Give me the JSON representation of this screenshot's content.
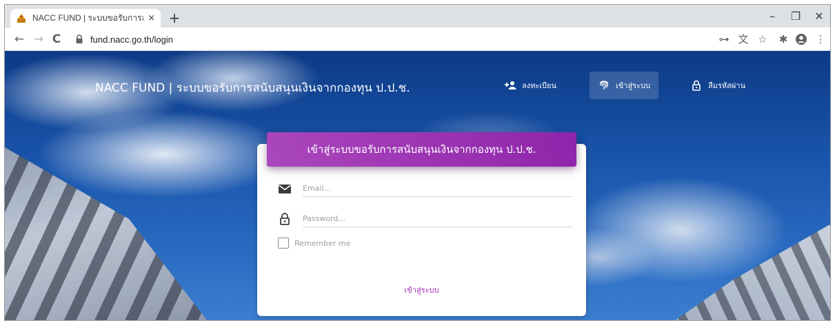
{
  "browser": {
    "tab_title": "NACC FUND | ระบบขอรับการสนับสนุนเงินจากกองทุน ป.ป.ช.",
    "tab_close": "×",
    "new_tab": "+",
    "url": "fund.nacc.go.th/login",
    "window_controls": {
      "minimize": "–",
      "restore": "❐",
      "close": "✕"
    },
    "nav": {
      "back": "←",
      "forward": "→",
      "reload": "C"
    },
    "toolbar_icons": {
      "key": "⊶",
      "translate": "⽂",
      "star": "☆",
      "extensions": "✱",
      "menu": "⋮"
    }
  },
  "page": {
    "brand": "NACC FUND | ระบบขอรับการสนับสนุนเงินจากกองทุน ป.ป.ช.",
    "nav_links": [
      {
        "label": "ลงทะเบียน",
        "icon": "add-user-icon"
      },
      {
        "label": "เข้าสู่ระบบ",
        "icon": "fingerprint-icon",
        "active": true
      },
      {
        "label": "ลืมรหัสผ่าน",
        "icon": "lock-icon"
      }
    ],
    "login": {
      "title": "เข้าสู่ระบบขอรับการสนับสนุนเงินจากกองทุน ป.ป.ช.",
      "email_placeholder": "Email...",
      "password_placeholder": "Password...",
      "remember_label": "Remember me",
      "submit_label": "เข้าสู่ระบบ"
    },
    "colors": {
      "accent": "#9c27b0",
      "header_gradient_start": "#ab47bc",
      "header_gradient_end": "#8e24aa"
    }
  }
}
